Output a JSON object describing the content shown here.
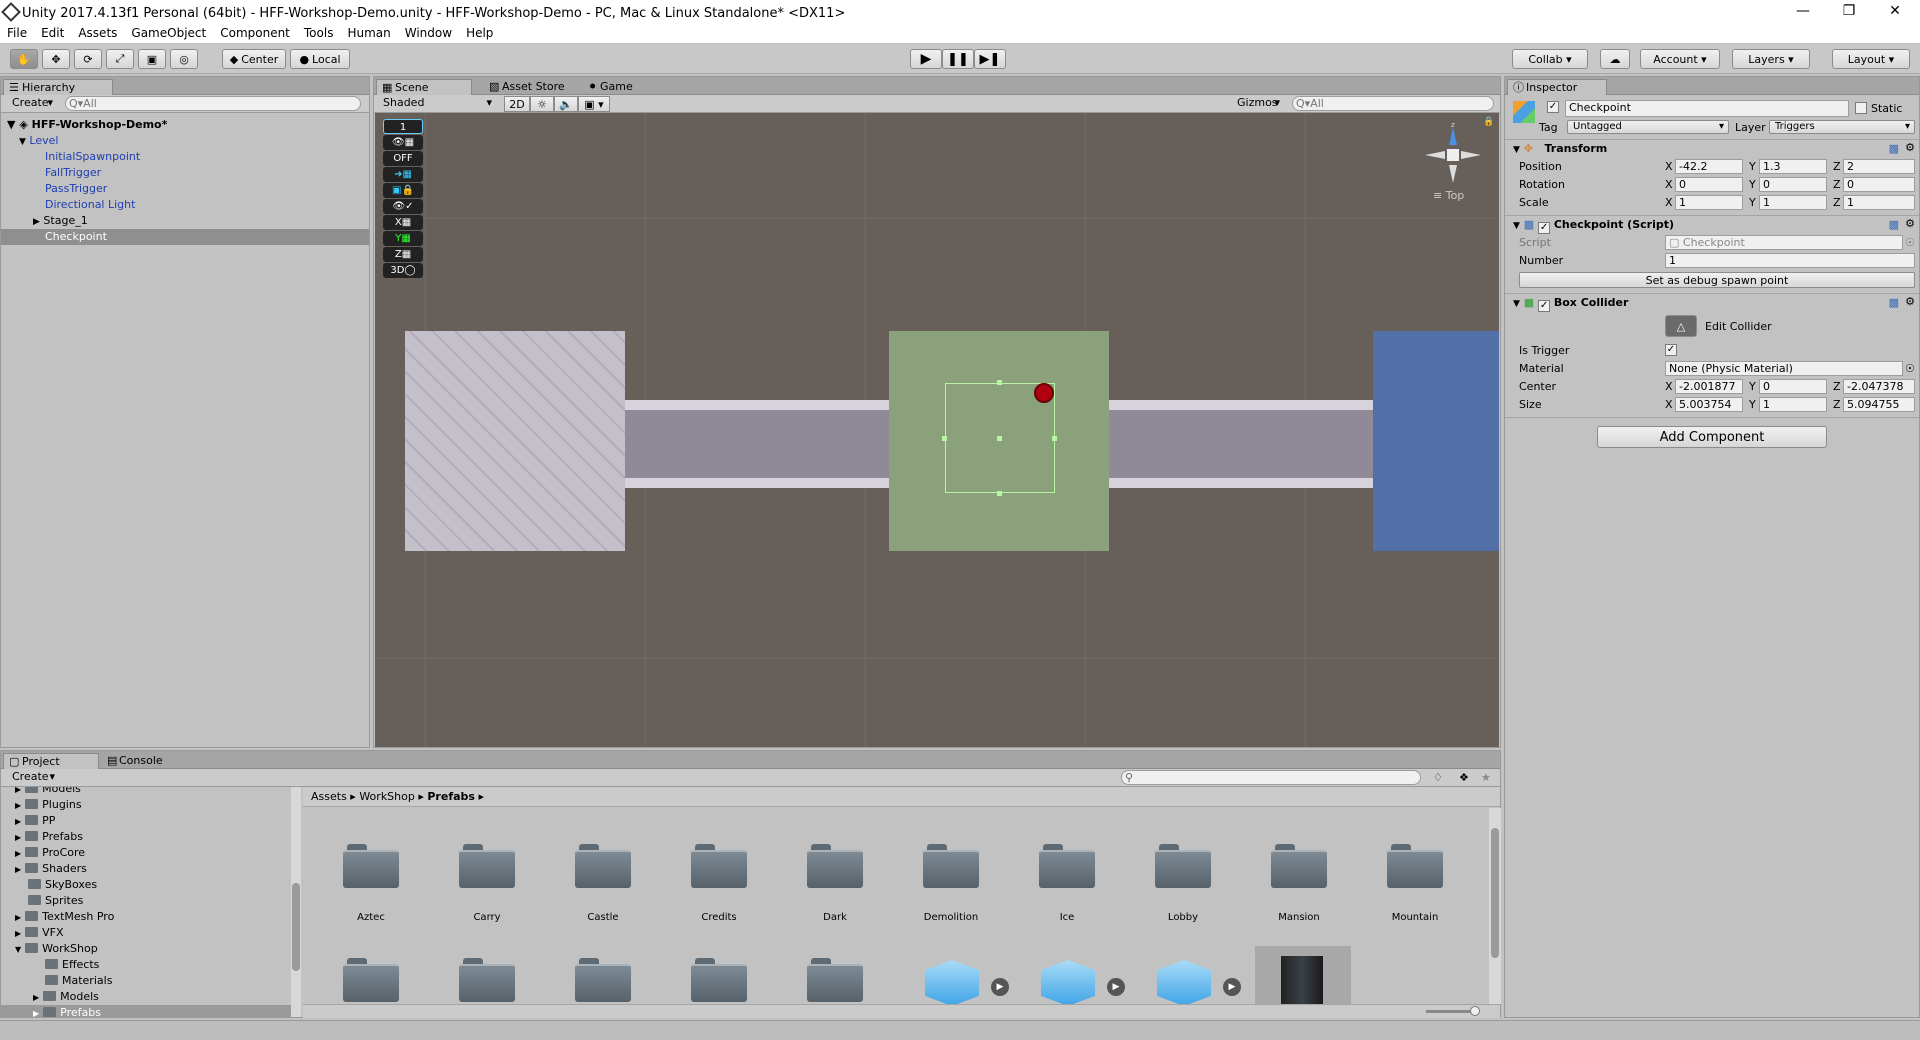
{
  "window": {
    "title": "Unity 2017.4.13f1 Personal (64bit) - HFF-Workshop-Demo.unity - HFF-Workshop-Demo - PC, Mac & Linux Standalone* <DX11>"
  },
  "menu": [
    "File",
    "Edit",
    "Assets",
    "GameObject",
    "Component",
    "Tools",
    "Human",
    "Window",
    "Help"
  ],
  "toolbar": {
    "pivot": "Center",
    "space": "Local",
    "collab": "Collab ▾",
    "account": "Account",
    "layers": "Layers",
    "layout": "Layout"
  },
  "hierarchy": {
    "tab": "Hierarchy",
    "create": "Create",
    "search_placeholder": "Q▾All",
    "scene": "HFF-Workshop-Demo*",
    "items": [
      {
        "label": "Level",
        "color": "#1f3fb0"
      },
      {
        "label": "InitialSpawnpoint",
        "color": "#1f3fb0"
      },
      {
        "label": "FallTrigger",
        "color": "#1f3fb0"
      },
      {
        "label": "PassTrigger",
        "color": "#1f3fb0"
      },
      {
        "label": "Directional Light",
        "color": "#1f3fb0"
      },
      {
        "label": "Stage_1",
        "color": "#000000"
      },
      {
        "label": "Checkpoint",
        "color": "#ffffff"
      }
    ]
  },
  "scene": {
    "tabs": [
      "Scene",
      "Asset Store",
      "Game"
    ],
    "shading": "Shaded",
    "mode2d": "2D",
    "gizmos": "Gizmos",
    "search_placeholder": "Q▾All",
    "gizmo_label": "Top",
    "side_tools": [
      "1",
      "",
      "OFF",
      "",
      "",
      "X",
      "Y",
      "Z",
      "3D"
    ]
  },
  "inspector": {
    "tab": "Inspector",
    "name": "Checkpoint",
    "static": "Static",
    "tag_label": "Tag",
    "tag": "Untagged",
    "layer_label": "Layer",
    "layer": "Triggers",
    "transform": {
      "title": "Transform",
      "position": {
        "label": "Position",
        "x": "-42.2",
        "y": "1.3",
        "z": "2"
      },
      "rotation": {
        "label": "Rotation",
        "x": "0",
        "y": "0",
        "z": "0"
      },
      "scale": {
        "label": "Scale",
        "x": "1",
        "y": "1",
        "z": "1"
      }
    },
    "script": {
      "title": "Checkpoint (Script)",
      "script_label": "Script",
      "script_value": "Checkpoint",
      "number_label": "Number",
      "number_value": "1",
      "debug_button": "Set as debug spawn point"
    },
    "collider": {
      "title": "Box Collider",
      "edit": "Edit Collider",
      "trigger_label": "Is Trigger",
      "material_label": "Material",
      "material": "None (Physic Material)",
      "center": {
        "label": "Center",
        "x": "-2.001877",
        "y": "0",
        "z": "-2.047378"
      },
      "size": {
        "label": "Size",
        "x": "5.003754",
        "y": "1",
        "z": "5.094755"
      }
    },
    "add_component": "Add Component"
  },
  "project": {
    "tabs": [
      "Project",
      "Console"
    ],
    "create": "Create",
    "breadcrumb": [
      "Assets",
      "WorkShop",
      "Prefabs"
    ],
    "tree": [
      {
        "label": "Models",
        "indent": 0
      },
      {
        "label": "Plugins",
        "indent": 0
      },
      {
        "label": "PP",
        "indent": 0
      },
      {
        "label": "Prefabs",
        "indent": 0
      },
      {
        "label": "ProCore",
        "indent": 0
      },
      {
        "label": "Shaders",
        "indent": 0
      },
      {
        "label": "SkyBoxes",
        "indent": 0
      },
      {
        "label": "Sprites",
        "indent": 0
      },
      {
        "label": "TextMesh Pro",
        "indent": 0
      },
      {
        "label": "VFX",
        "indent": 0
      },
      {
        "label": "WorkShop",
        "indent": 0
      },
      {
        "label": "Effects",
        "indent": 1
      },
      {
        "label": "Materials",
        "indent": 1
      },
      {
        "label": "Models",
        "indent": 1
      },
      {
        "label": "Prefabs",
        "indent": 1
      }
    ],
    "folders": [
      "Aztec",
      "Carry",
      "Castle",
      "Credits",
      "Dark",
      "Demolition",
      "Ice",
      "Lobby",
      "Mansion",
      "Mountain"
    ]
  }
}
